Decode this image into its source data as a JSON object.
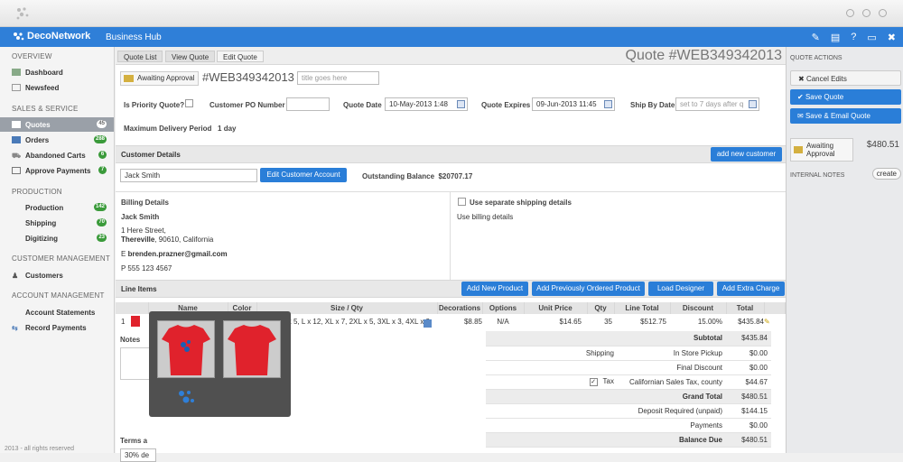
{
  "app": {
    "brand": "DecoNetwork",
    "title": "Business Hub"
  },
  "sidebar": {
    "sections": [
      "Overview",
      "Sales & Service",
      "Production",
      "Customer Management",
      "Account Management"
    ],
    "items": [
      {
        "label": "Dashboard"
      },
      {
        "label": "Newsfeed"
      },
      {
        "label": "Quotes",
        "badge": "45"
      },
      {
        "label": "Orders",
        "badge": "288"
      },
      {
        "label": "Abandoned Carts",
        "badge": "6"
      },
      {
        "label": "Approve Payments",
        "badge": "7"
      },
      {
        "label": "Production",
        "badge": "142"
      },
      {
        "label": "Shipping",
        "badge": "70"
      },
      {
        "label": "Digitizing",
        "badge": "23"
      },
      {
        "label": "Customers"
      },
      {
        "label": "Account Statements"
      },
      {
        "label": "Record Payments"
      }
    ],
    "footer": "2013 - all rights reserved"
  },
  "breadcrumbs": [
    "Quote List",
    "View Quote",
    "Edit Quote"
  ],
  "quote": {
    "heading": "Quote #WEB349342013",
    "status": "Awaiting Approval",
    "number": "#WEB349342013",
    "title_placeholder": "title goes here",
    "priority_label": "Is Priority Quote?",
    "po_label": "Customer PO Number",
    "date_label": "Quote Date",
    "date": "10-May-2013 1:48",
    "expires_label": "Quote Expires",
    "expires": "09-Jun-2013 11:45",
    "ship_label": "Ship By Date",
    "ship_placeholder": "set to 7 days after q",
    "delivery_label": "Maximum Delivery Period",
    "delivery": "1 day"
  },
  "customer": {
    "section": "Customer Details",
    "add_button": "add new customer",
    "name": "Jack Smith",
    "edit_button": "Edit Customer Account",
    "balance_label": "Outstanding Balance",
    "balance": "$20707.17",
    "billing_title": "Billing Details",
    "billing_name": "Jack Smith",
    "address1": "1 Here Street,",
    "address2": "Thereville",
    "address3": ", 90610, California",
    "email_prefix": "E ",
    "email": "brenden.prazner@gmail.com",
    "phone_prefix": "P ",
    "phone": "555 123 4567",
    "shipping_check": "Use separate shipping details",
    "shipping_text": "Use billing details"
  },
  "line_items": {
    "section": "Line Items",
    "buttons": [
      "Add New Product",
      "Add Previously Ordered Product",
      "Load Designer",
      "Add Extra Charge"
    ],
    "columns": [
      "Name",
      "Color",
      "Size / Qty",
      "Decorations",
      "Options",
      "Unit Price",
      "Qty",
      "Line Total",
      "Discount",
      "Total"
    ],
    "row": {
      "num": "1",
      "sizes": "x 5, L x 12, XL x 7, 2XL x 5, 3XL x 3, 4XL x 2",
      "decorations": "$8.85",
      "options": "N/A",
      "unit_price": "$14.65",
      "qty": "35",
      "line_total": "$512.75",
      "discount": "15.00%",
      "total": "$435.84"
    }
  },
  "notes_label": "Notes",
  "terms_label": "Terms a",
  "terms_value": "30% de",
  "totals": [
    {
      "label": "Subtotal",
      "value": "$435.84",
      "bold": true
    },
    {
      "label": "Shipping",
      "sub": "In Store Pickup",
      "value": "$0.00"
    },
    {
      "label": "Final Discount",
      "value": "$0.00"
    },
    {
      "label": "Tax",
      "sub": "Californian Sales Tax, county",
      "value": "$44.67"
    },
    {
      "label": "Grand Total",
      "value": "$480.51",
      "bold": true
    },
    {
      "label": "Deposit Required (unpaid)",
      "value": "$144.15"
    },
    {
      "label": "Payments",
      "value": "$0.00"
    },
    {
      "label": "Balance Due",
      "value": "$480.51",
      "bold": true
    }
  ],
  "actions": {
    "title": "Quote Actions",
    "cancel": "Cancel Edits",
    "save": "Save Quote",
    "save_email": "Save & Email Quote",
    "status": "Awaiting Approval",
    "amount": "$480.51",
    "notes_title": "Internal Notes",
    "create": "create"
  },
  "colors": {
    "accent": "#2f7fd8",
    "badge": "#3a9a3a",
    "shirt": "#e0222c"
  }
}
